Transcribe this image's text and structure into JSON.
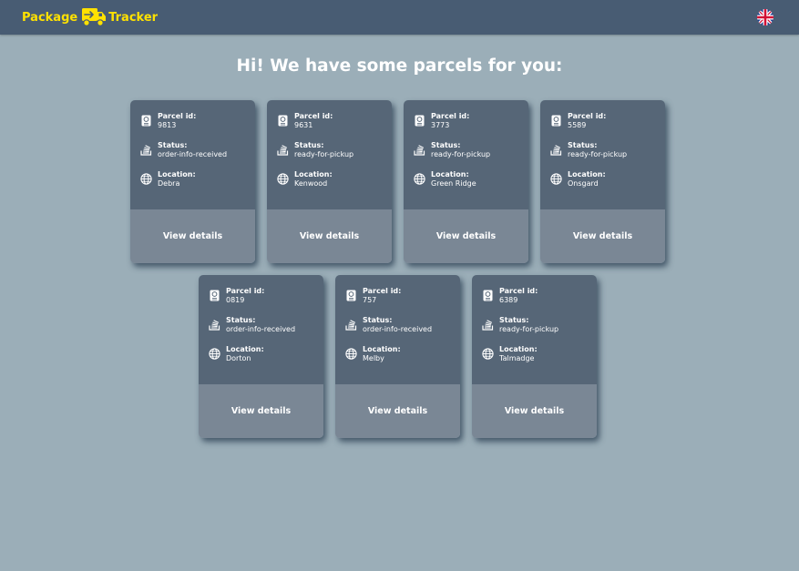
{
  "header": {
    "brand_left": "Package",
    "brand_right": "Tracker",
    "language": "English"
  },
  "main": {
    "title": "Hi! We have some parcels for you:"
  },
  "labels": {
    "parcel_id": "Parcel id:",
    "status": "Status:",
    "location": "Location:",
    "view_details": "View details"
  },
  "parcels": [
    {
      "id": "9813",
      "status": "order-info-received",
      "location": "Debra"
    },
    {
      "id": "9631",
      "status": "ready-for-pickup",
      "location": "Kenwood"
    },
    {
      "id": "3773",
      "status": "ready-for-pickup",
      "location": "Green Ridge"
    },
    {
      "id": "5589",
      "status": "ready-for-pickup",
      "location": "Onsgard"
    },
    {
      "id": "0819",
      "status": "order-info-received",
      "location": "Dorton"
    },
    {
      "id": "757",
      "status": "order-info-received",
      "location": "Melby"
    },
    {
      "id": "6389",
      "status": "ready-for-pickup",
      "location": "Talmadge"
    }
  ],
  "colors": {
    "background": "#9baeb8",
    "header": "#485c73",
    "brand": "#ffe100",
    "card_top": "#566677",
    "card_bottom": "#7a8795"
  },
  "icons": {
    "brand": "truck-icon",
    "language": "uk-flag-icon",
    "parcel_id": "passport-icon",
    "status": "stack-icon",
    "location": "globe-icon"
  }
}
